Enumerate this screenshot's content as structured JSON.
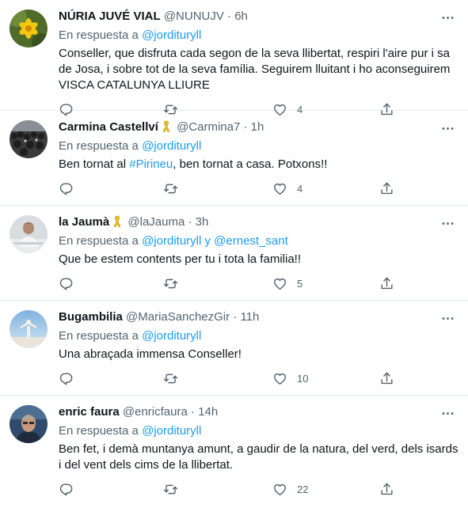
{
  "tweets": [
    {
      "name": "NÚRIA JUVÉ VIAL",
      "handle": "@NUNUJV",
      "time": "6h",
      "reply_prefix": "En respuesta a",
      "reply_to": "@jordituryll",
      "text": "Conseller, que disfruta cada segon de la seva llibertat, respiri l'aire pur i sa de Josa, i sobre tot de la seva família. Seguirem lluitant i ho aconseguirem VISCA CATALUNYA LLIURE",
      "likes": "4"
    },
    {
      "name": "Carmina Castellví",
      "handle": "@Carmina7",
      "time": "1h",
      "reply_prefix": "En respuesta a",
      "reply_to": "@jordituryll",
      "text_before": "Ben tornat al ",
      "hashtag": "#Pirineu",
      "text_after": ", ben tornat a casa. Potxons!!",
      "likes": "4"
    },
    {
      "name": "la Jaumà",
      "handle": "@laJauma",
      "time": "3h",
      "reply_prefix": "En respuesta a",
      "reply_to": "@jordituryll",
      "reply_joiner": "y",
      "reply_to_2": "@ernest_sant",
      "text": "Que be estem contents per tu i tota la familia!!",
      "likes": "5"
    },
    {
      "name": "Bugambilia",
      "handle": "@MariaSanchezGir",
      "time": "11h",
      "reply_prefix": "En respuesta a",
      "reply_to": "@jordituryll",
      "text": "Una abraçada immensa Conseller!",
      "likes": "10"
    },
    {
      "name": "enric faura",
      "handle": "@enricfaura",
      "time": "14h",
      "reply_prefix": "En respuesta a",
      "reply_to": "@jordituryll",
      "text": "Ben fet, i demà muntanya amunt, a gaudir de la natura, del verd, dels isards i del vent dels cims de la llibertat.",
      "likes": "22"
    }
  ],
  "icons": {
    "reply": "reply-icon",
    "retweet": "retweet-icon",
    "like": "heart-icon",
    "share": "share-icon",
    "more": "more-icon",
    "ribbon": "yellow-ribbon-icon"
  },
  "colors": {
    "link": "#1d9bf0",
    "secondary": "#536471",
    "ribbon": "#f5c518"
  }
}
